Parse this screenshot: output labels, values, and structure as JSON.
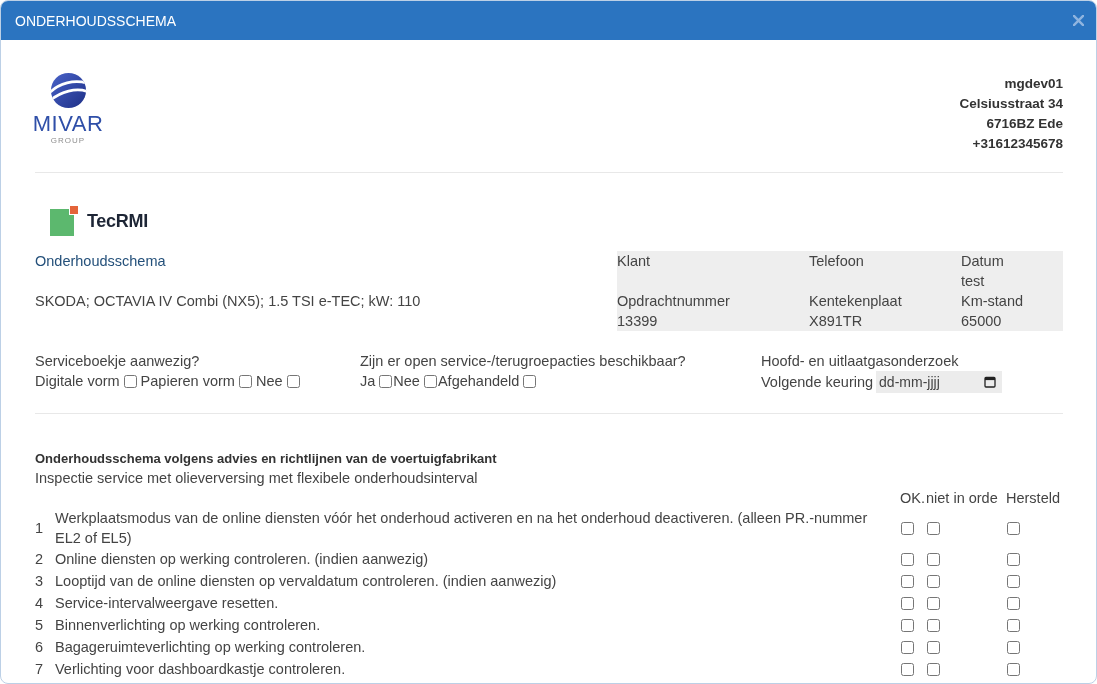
{
  "window": {
    "title": "ONDERHOUDSSCHEMA"
  },
  "brand": {
    "name": "MIVAR",
    "tagline": "GROUP"
  },
  "company_address": [
    "mgdev01",
    "Celsiusstraat 34",
    "6716BZ Ede",
    "+31612345678"
  ],
  "source_logo": {
    "name": "TecRMI"
  },
  "section_title": "Onderhoudsschema",
  "vehicle": "SKODA; OCTAVIA IV Combi (NX5); 1.5 TSI e-TEC; kW: 110",
  "info_table": {
    "fields": [
      {
        "label": "Klant"
      },
      {
        "label": "Telefoon"
      },
      {
        "label": "Datum",
        "value": "test"
      },
      {
        "label": "Opdrachtnummer",
        "value": "13399"
      },
      {
        "label": "Kentekenplaat",
        "value": "X891TR"
      },
      {
        "label": "Km-stand",
        "value": "65000"
      }
    ]
  },
  "service_book": {
    "question": "Serviceboekje aanwezig?",
    "options": [
      {
        "label": "Digitale vorm",
        "checked": false
      },
      {
        "label": "Papieren vorm",
        "checked": false
      },
      {
        "label": "Nee",
        "checked": false
      }
    ]
  },
  "recalls": {
    "question": "Zijn er open service-/terugroepacties beschikbaar?",
    "options": [
      {
        "label": "Ja",
        "checked": false
      },
      {
        "label": "Nee",
        "checked": false
      },
      {
        "label": "Afgehandeld",
        "checked": false
      }
    ]
  },
  "emissions_test": {
    "title": "Hoofd- en uitlaatgasonderzoek",
    "field_label": "Volgende keuring",
    "placeholder": "dd-mm-jjjj"
  },
  "checklist": {
    "title": "Onderhoudsschema volgens advies en richtlijnen van de voertuigfabrikant",
    "subtitle": "Inspectie service met olieverversing met flexibele onderhoudsinterval",
    "columns": [
      "OK.",
      "niet in orde",
      "Hersteld"
    ],
    "items": [
      {
        "number": "1",
        "text": "Werkplaatsmodus van de online diensten vóór het onderhoud activeren en na het onderhoud deactiveren. (alleen PR.-nummer EL2 of EL5)",
        "ok": false,
        "not_ok": false,
        "repaired": false
      },
      {
        "number": "2",
        "text": "Online diensten op werking controleren. (indien aanwezig)",
        "ok": false,
        "not_ok": false,
        "repaired": false
      },
      {
        "number": "3",
        "text": "Looptijd van de online diensten op vervaldatum controleren. (indien aanwezig)",
        "ok": false,
        "not_ok": false,
        "repaired": false
      },
      {
        "number": "4",
        "text": "Service-intervalweergave resetten.",
        "ok": false,
        "not_ok": false,
        "repaired": false
      },
      {
        "number": "5",
        "text": "Binnenverlichting op werking controleren.",
        "ok": false,
        "not_ok": false,
        "repaired": false
      },
      {
        "number": "6",
        "text": "Bagageruimteverlichting op werking controleren.",
        "ok": false,
        "not_ok": false,
        "repaired": false
      },
      {
        "number": "7",
        "text": "Verlichting voor dashboardkastje controleren.",
        "ok": false,
        "not_ok": false,
        "repaired": false
      }
    ]
  }
}
